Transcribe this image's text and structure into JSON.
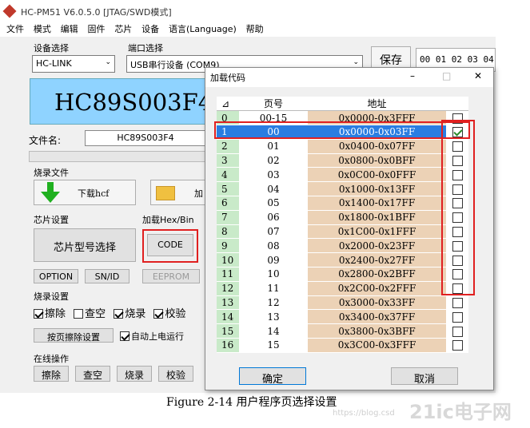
{
  "app": {
    "title": "HC-PM51 V6.0.5.0  [JTAG/SWD模式]",
    "menu": [
      "文件",
      "模式",
      "编辑",
      "固件",
      "芯片",
      "设备",
      "语言(Language)",
      "帮助"
    ]
  },
  "device": {
    "group_label": "设备选择",
    "value": "HC-LINK"
  },
  "port": {
    "group_label": "端口选择",
    "value": "USB串行设备 (COM9)"
  },
  "save_label": "保存",
  "hex_preview": "00 01 02 03 04",
  "chip_banner": "HC89S003F4",
  "file": {
    "label": "文件名:",
    "value": "HC89S003F4"
  },
  "burn_file": {
    "group_label": "烧录文件",
    "download_label": "下载hcf",
    "load_label": "加"
  },
  "chip_settings": {
    "group_label": "芯片设置",
    "select_label": "芯片型号选择",
    "option_label": "OPTION",
    "snid_label": "SN/ID"
  },
  "load_hex": {
    "group_label": "加载Hex/Bin",
    "code_label": "CODE",
    "eeprom_label": "EEPROM"
  },
  "burn_settings": {
    "group_label": "烧录设置",
    "options": [
      {
        "label": "擦除",
        "checked": true
      },
      {
        "label": "查空",
        "checked": false
      },
      {
        "label": "烧录",
        "checked": true
      },
      {
        "label": "校验",
        "checked": true
      }
    ],
    "page_erase_label": "按页擦除设置",
    "auto_power_label": "自动上电运行",
    "auto_power_checked": true
  },
  "online": {
    "group_label": "在线操作",
    "buttons": [
      "擦除",
      "查空",
      "烧录",
      "校验"
    ]
  },
  "dialog": {
    "title": "加载代码",
    "headers": [
      "⊿",
      "页号",
      "地址",
      ""
    ],
    "rows": [
      {
        "idx": "0",
        "page": "00-15",
        "addr": "0x0000-0x3FFF",
        "checked": false
      },
      {
        "idx": "1",
        "page": "00",
        "addr": "0x0000-0x03FF",
        "checked": true
      },
      {
        "idx": "2",
        "page": "01",
        "addr": "0x0400-0x07FF",
        "checked": false
      },
      {
        "idx": "3",
        "page": "02",
        "addr": "0x0800-0x0BFF",
        "checked": false
      },
      {
        "idx": "4",
        "page": "03",
        "addr": "0x0C00-0x0FFF",
        "checked": false
      },
      {
        "idx": "5",
        "page": "04",
        "addr": "0x1000-0x13FF",
        "checked": false
      },
      {
        "idx": "6",
        "page": "05",
        "addr": "0x1400-0x17FF",
        "checked": false
      },
      {
        "idx": "7",
        "page": "06",
        "addr": "0x1800-0x1BFF",
        "checked": false
      },
      {
        "idx": "8",
        "page": "07",
        "addr": "0x1C00-0x1FFF",
        "checked": false
      },
      {
        "idx": "9",
        "page": "08",
        "addr": "0x2000-0x23FF",
        "checked": false
      },
      {
        "idx": "10",
        "page": "09",
        "addr": "0x2400-0x27FF",
        "checked": false
      },
      {
        "idx": "11",
        "page": "10",
        "addr": "0x2800-0x2BFF",
        "checked": false
      },
      {
        "idx": "12",
        "page": "11",
        "addr": "0x2C00-0x2FFF",
        "checked": false
      },
      {
        "idx": "13",
        "page": "12",
        "addr": "0x3000-0x33FF",
        "checked": false
      },
      {
        "idx": "14",
        "page": "13",
        "addr": "0x3400-0x37FF",
        "checked": false
      },
      {
        "idx": "15",
        "page": "14",
        "addr": "0x3800-0x3BFF",
        "checked": false
      },
      {
        "idx": "16",
        "page": "15",
        "addr": "0x3C00-0x3FFF",
        "checked": false
      }
    ],
    "ok_label": "确定",
    "cancel_label": "取消",
    "minimize": "–",
    "maximize": "□",
    "close": "✕"
  },
  "caption": "Figure 2-14 用户程序页选择设置",
  "watermark_url": "https://blog.csd",
  "watermark_logo": "21ic电子网",
  "colors": {
    "selection": "#2a7de1",
    "highlight": "#e02020",
    "addr_bg": "#ecd2b6",
    "idx_bg": "#c9eac9"
  }
}
